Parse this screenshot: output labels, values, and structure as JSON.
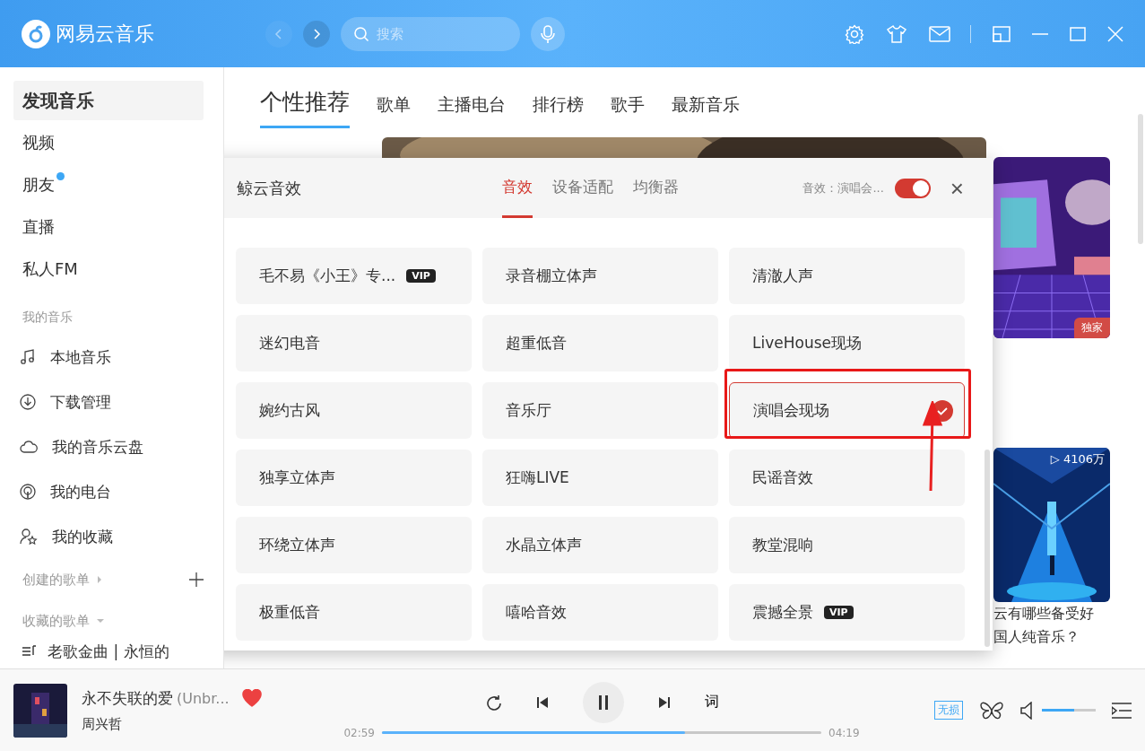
{
  "app": {
    "name": "网易云音乐",
    "search_placeholder": "搜索"
  },
  "sidebar": {
    "items": [
      {
        "label": "发现音乐",
        "selected": true,
        "dot": false
      },
      {
        "label": "视频",
        "selected": false,
        "dot": false
      },
      {
        "label": "朋友",
        "selected": false,
        "dot": true
      },
      {
        "label": "直播",
        "selected": false,
        "dot": false
      },
      {
        "label": "私人FM",
        "selected": false,
        "dot": false
      }
    ],
    "my_music_title": "我的音乐",
    "my_music": [
      "本地音乐",
      "下载管理",
      "我的音乐云盘",
      "我的电台",
      "我的收藏"
    ],
    "created_title": "创建的歌单",
    "collected_title": "收藏的歌单",
    "playlists": [
      "老歌金曲 | 永恒的"
    ]
  },
  "tabs": [
    {
      "label": "个性推荐",
      "selected": true
    },
    {
      "label": "歌单",
      "selected": false
    },
    {
      "label": "主播电台",
      "selected": false
    },
    {
      "label": "排行榜",
      "selected": false
    },
    {
      "label": "歌手",
      "selected": false
    },
    {
      "label": "最新音乐",
      "selected": false
    }
  ],
  "cards": [
    {
      "badge": "独家"
    },
    {
      "play_count": "▷ 4106万",
      "title_lines": [
        "云有哪些备受好",
        "国人纯音乐？"
      ]
    }
  ],
  "dialog": {
    "title": "鲸云音效",
    "tabs": [
      {
        "label": "音效",
        "selected": true
      },
      {
        "label": "设备适配",
        "selected": false
      },
      {
        "label": "均衡器",
        "selected": false
      }
    ],
    "status": "音效：演唱会...",
    "on": true,
    "close": "×",
    "effects": [
      {
        "name": "毛不易《小王》专...",
        "badge": "VIP",
        "selected": false
      },
      {
        "name": "录音棚立体声",
        "selected": false
      },
      {
        "name": "清澈人声",
        "selected": false
      },
      {
        "name": "迷幻电音",
        "selected": false
      },
      {
        "name": "超重低音",
        "selected": false
      },
      {
        "name": "LiveHouse现场",
        "selected": false
      },
      {
        "name": "婉约古风",
        "selected": false
      },
      {
        "name": "音乐厅",
        "selected": false
      },
      {
        "name": "演唱会现场",
        "selected": true
      },
      {
        "name": "独享立体声",
        "selected": false
      },
      {
        "name": "狂嗨LIVE",
        "selected": false
      },
      {
        "name": "民谣音效",
        "selected": false
      },
      {
        "name": "环绕立体声",
        "selected": false
      },
      {
        "name": "水晶立体声",
        "selected": false
      },
      {
        "name": "教堂混响",
        "selected": false
      },
      {
        "name": "极重低音",
        "selected": false
      },
      {
        "name": "嘻哈音效",
        "selected": false
      },
      {
        "name": "震撼全景",
        "badge": "VIP",
        "selected": false
      }
    ]
  },
  "player": {
    "title": "永不失联的爱",
    "subtitle": "(Unbr...",
    "artist": "周兴哲",
    "liked": true,
    "lyrics": "词",
    "elapsed": "02:59",
    "total": "04:19",
    "level": 0.69,
    "quality": "无损",
    "volume": {
      "level": 0.6
    }
  }
}
